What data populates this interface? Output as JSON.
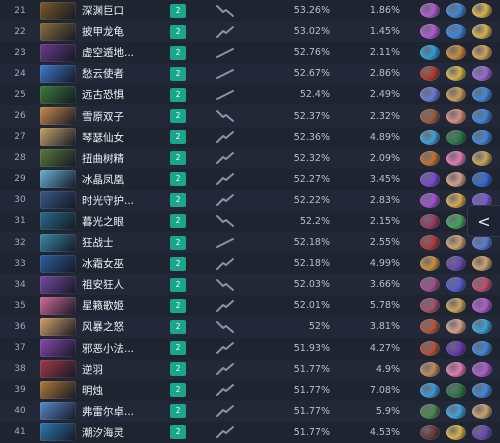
{
  "rows": [
    {
      "rank": "21",
      "name": "深渊巨口",
      "tier": "2",
      "winrate": "53.26%",
      "pickrate": "1.86%",
      "avatar_color": "#7b5a2c",
      "trend": "down",
      "counters": [
        "#b05ad0",
        "#3f86d8",
        "#d8b24a"
      ]
    },
    {
      "rank": "22",
      "name": "披甲龙龟",
      "tier": "2",
      "winrate": "53.02%",
      "pickrate": "1.45%",
      "avatar_color": "#8a6f3c",
      "trend": "up",
      "counters": [
        "#b05ad0",
        "#3f86d8",
        "#d8b24a"
      ]
    },
    {
      "rank": "23",
      "name": "虚空遁地...",
      "tier": "2",
      "winrate": "52.76%",
      "pickrate": "2.11%",
      "avatar_color": "#6a3d8a",
      "trend": "flat",
      "counters": [
        "#2aa0d6",
        "#c98b3a",
        "#d1a05b"
      ]
    },
    {
      "rank": "24",
      "name": "愁云使者",
      "tier": "2",
      "winrate": "52.67%",
      "pickrate": "2.86%",
      "avatar_color": "#3f7bc9",
      "trend": "flat",
      "counters": [
        "#b23b2b",
        "#d6b24a",
        "#9b6bd0"
      ]
    },
    {
      "rank": "25",
      "name": "远古恐惧",
      "tier": "2",
      "winrate": "52.4%",
      "pickrate": "2.49%",
      "avatar_color": "#3e7b3b",
      "trend": "flat",
      "counters": [
        "#6a7bd4",
        "#c79d55",
        "#3f86d8"
      ]
    },
    {
      "rank": "26",
      "name": "雪原双子",
      "tier": "2",
      "winrate": "52.37%",
      "pickrate": "2.32%",
      "avatar_color": "#c88b4a",
      "trend": "down",
      "counters": [
        "#9a5b3b",
        "#d98b7a",
        "#3f86d8"
      ]
    },
    {
      "rank": "27",
      "name": "琴瑟仙女",
      "tier": "2",
      "winrate": "52.36%",
      "pickrate": "4.89%",
      "avatar_color": "#c3a46a",
      "trend": "up",
      "counters": [
        "#3fa0d6",
        "#2e7a45",
        "#3f86d8"
      ]
    },
    {
      "rank": "28",
      "name": "扭曲树精",
      "tier": "2",
      "winrate": "52.32%",
      "pickrate": "2.09%",
      "avatar_color": "#5a7a3b",
      "trend": "up",
      "counters": [
        "#c2702a",
        "#e27ab0",
        "#c7a35a"
      ]
    },
    {
      "rank": "29",
      "name": "冰晶凤凰",
      "tier": "2",
      "winrate": "52.27%",
      "pickrate": "3.45%",
      "avatar_color": "#6ab3d6",
      "trend": "up",
      "counters": [
        "#7c4ad0",
        "#d49e86",
        "#2d6ed3"
      ]
    },
    {
      "rank": "30",
      "name": "时光守护...",
      "tier": "2",
      "winrate": "52.22%",
      "pickrate": "2.83%",
      "avatar_color": "#3a5a8a",
      "trend": "up",
      "counters": [
        "#a14fd0",
        "#d8a94a",
        "#7a5ad6"
      ]
    },
    {
      "rank": "31",
      "name": "暮光之眼",
      "tier": "2",
      "winrate": "52.2%",
      "pickrate": "2.15%",
      "avatar_color": "#2c6b8a",
      "trend": "down",
      "counters": [
        "#9a3b62",
        "#44a35b",
        "#b56f5a"
      ]
    },
    {
      "rank": "32",
      "name": "狂战士",
      "tier": "2",
      "winrate": "52.18%",
      "pickrate": "2.55%",
      "avatar_color": "#3a8aa3",
      "trend": "flat",
      "counters": [
        "#b03a3a",
        "#c9a26a",
        "#5b7bd6"
      ]
    },
    {
      "rank": "33",
      "name": "冰霜女巫",
      "tier": "2",
      "winrate": "52.18%",
      "pickrate": "4.99%",
      "avatar_color": "#2f5fa0",
      "trend": "up",
      "counters": [
        "#c98f3a",
        "#6a4ab0",
        "#d2a36a"
      ]
    },
    {
      "rank": "34",
      "name": "祖安狂人",
      "tier": "2",
      "winrate": "52.03%",
      "pickrate": "3.66%",
      "avatar_color": "#7a4aa3",
      "trend": "down",
      "counters": [
        "#a34f8a",
        "#5a5ad0",
        "#c24f6a"
      ]
    },
    {
      "rank": "35",
      "name": "星籁歌姬",
      "tier": "2",
      "winrate": "52.01%",
      "pickrate": "5.78%",
      "avatar_color": "#d66a9a",
      "trend": "up",
      "counters": [
        "#a5506a",
        "#c9a25a",
        "#b05ad0"
      ]
    },
    {
      "rank": "36",
      "name": "风暴之怒",
      "tier": "2",
      "winrate": "52%",
      "pickrate": "3.81%",
      "avatar_color": "#d6a36a",
      "trend": "down",
      "counters": [
        "#b5553a",
        "#d49e86",
        "#3aa0d6"
      ]
    },
    {
      "rank": "37",
      "name": "邪恶小法...",
      "tier": "2",
      "winrate": "51.93%",
      "pickrate": "4.27%",
      "avatar_color": "#8a4ab0",
      "trend": "up",
      "counters": [
        "#b5503a",
        "#6a3bb0",
        "#3f86d8"
      ]
    },
    {
      "rank": "38",
      "name": "逆羽",
      "tier": "2",
      "winrate": "51.77%",
      "pickrate": "4.9%",
      "avatar_color": "#a33a4a",
      "trend": "up",
      "counters": [
        "#c08a5a",
        "#e27ab0",
        "#b05ad0"
      ]
    },
    {
      "rank": "39",
      "name": "明烛",
      "tier": "2",
      "winrate": "51.77%",
      "pickrate": "7.08%",
      "avatar_color": "#b07a3a",
      "trend": "up",
      "counters": [
        "#3a9ad6",
        "#2e7a45",
        "#3f86d8"
      ]
    },
    {
      "rank": "40",
      "name": "弗雷尔卓...",
      "tier": "2",
      "winrate": "51.77%",
      "pickrate": "5.9%",
      "avatar_color": "#5a8ac9",
      "trend": "up",
      "counters": [
        "#4a8a4a",
        "#3fa0d6",
        "#c9a26a"
      ]
    },
    {
      "rank": "41",
      "name": "潮汐海灵",
      "tier": "2",
      "winrate": "51.77%",
      "pickrate": "4.53%",
      "avatar_color": "#2f7ab0",
      "trend": "up",
      "counters": [
        "#6a3a3a",
        "#d8b24a",
        "#6a4ab0"
      ]
    }
  ],
  "side_tab_glyph": "<",
  "colors": {
    "tier_badge": "#1aa58d",
    "background": "#1b1f2b"
  }
}
